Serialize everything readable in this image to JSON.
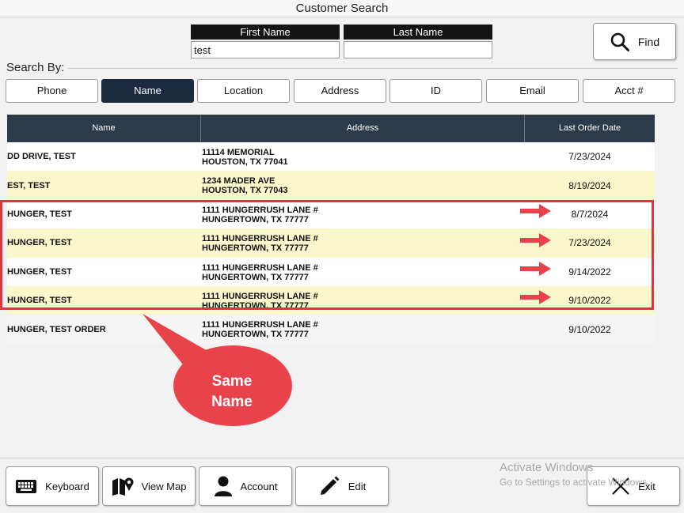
{
  "window": {
    "title": "Customer Search"
  },
  "search": {
    "first_name_label": "First Name",
    "first_name_value": "test",
    "last_name_label": "Last Name",
    "last_name_value": "",
    "find_label": "Find"
  },
  "search_by": {
    "label": "Search By:",
    "options": [
      "Phone",
      "Name",
      "Location",
      "Address",
      "ID",
      "Email",
      "Acct #"
    ],
    "selected": "Name"
  },
  "grid": {
    "columns": [
      "Name",
      "Address",
      "Last Order Date"
    ],
    "rows": [
      {
        "name": "DD DRIVE, TEST",
        "address1": "11114 MEMORIAL",
        "address2": "HOUSTON, TX 77041",
        "date": "7/23/2024"
      },
      {
        "name": "EST, TEST",
        "address1": "1234 MADER AVE",
        "address2": "HOUSTON, TX 77043",
        "date": "8/19/2024"
      },
      {
        "name": "HUNGER, TEST",
        "address1": "1111 HUNGERRUSH LANE #",
        "address2": "HUNGERTOWN, TX 77777",
        "date": "8/7/2024"
      },
      {
        "name": "HUNGER, TEST",
        "address1": "1111 HUNGERRUSH LANE #",
        "address2": "HUNGERTOWN, TX 77777",
        "date": "7/23/2024"
      },
      {
        "name": "HUNGER, TEST",
        "address1": "1111 HUNGERRUSH LANE #",
        "address2": "HUNGERTOWN, TX 77777",
        "date": "9/14/2022"
      },
      {
        "name": "HUNGER, TEST",
        "address1": "1111 HUNGERRUSH LANE #",
        "address2": "HUNGERTOWN, TX 77777",
        "date": "9/10/2022"
      },
      {
        "name": "HUNGER, TEST ORDER",
        "address1": "1111 HUNGERRUSH LANE #",
        "address2": "HUNGERTOWN, TX 77777",
        "date": "9/10/2022"
      }
    ]
  },
  "annotation": {
    "callout_line1": "Same",
    "callout_line2": "Name",
    "color": "#e8424b"
  },
  "footer": {
    "keyboard_label": "Keyboard",
    "view_map_label": "View Map",
    "account_label": "Account",
    "edit_label": "Edit",
    "exit_label": "Exit"
  },
  "watermark": {
    "line1": "Activate Windows",
    "line2": "Go to Settings to activate Windows."
  },
  "colors": {
    "header_bg": "#2c3a4a",
    "selected_tab_bg": "#1b2a3d",
    "row_alt_bg": "#fbf7cc"
  }
}
